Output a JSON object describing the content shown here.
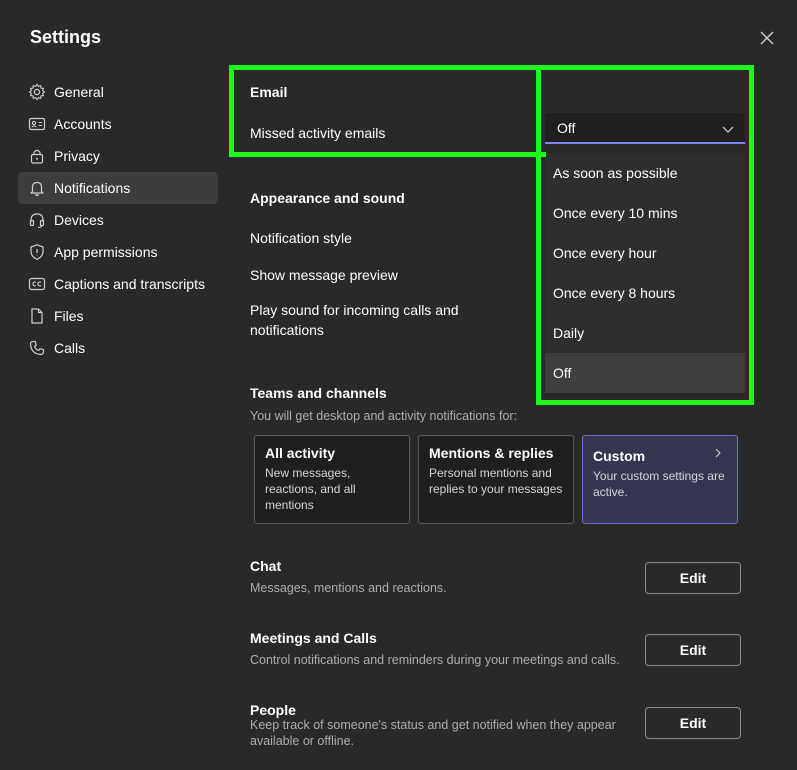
{
  "window": {
    "title": "Settings"
  },
  "sidebar": {
    "items": [
      {
        "label": "General",
        "icon": "gear-icon"
      },
      {
        "label": "Accounts",
        "icon": "id-card-icon"
      },
      {
        "label": "Privacy",
        "icon": "lock-icon"
      },
      {
        "label": "Notifications",
        "icon": "bell-icon",
        "active": true
      },
      {
        "label": "Devices",
        "icon": "headset-icon"
      },
      {
        "label": "App permissions",
        "icon": "shield-icon"
      },
      {
        "label": "Captions and transcripts",
        "icon": "cc-icon"
      },
      {
        "label": "Files",
        "icon": "file-icon"
      },
      {
        "label": "Calls",
        "icon": "phone-icon"
      }
    ]
  },
  "email": {
    "title": "Email",
    "missed_label": "Missed activity emails",
    "select_value": "Off",
    "options": [
      "As soon as possible",
      "Once every 10 mins",
      "Once every hour",
      "Once every 8 hours",
      "Daily",
      "Off"
    ],
    "selected_option": "Off"
  },
  "appearance": {
    "title": "Appearance and sound",
    "style_label": "Notification style",
    "preview_label": "Show message preview",
    "sound_label_1": "Play sound for incoming calls and",
    "sound_label_2": "notifications"
  },
  "teams": {
    "title": "Teams and channels",
    "subtitle": "You will get desktop and activity notifications for:",
    "cards": [
      {
        "title": "All activity",
        "desc": "New messages, reactions, and all mentions"
      },
      {
        "title": "Mentions & replies",
        "desc": "Personal mentions and replies to your messages"
      },
      {
        "title": "Custom",
        "desc": "Your custom settings are active."
      }
    ]
  },
  "chat": {
    "title": "Chat",
    "subtitle": "Messages, mentions and reactions.",
    "button": "Edit"
  },
  "meetings": {
    "title": "Meetings and Calls",
    "subtitle": "Control notifications and reminders during your meetings and calls.",
    "button": "Edit"
  },
  "people": {
    "title": "People",
    "subtitle_1": "Keep track of someone's status and get notified when they appear",
    "subtitle_2": "available or offline.",
    "button": "Edit"
  },
  "colors": {
    "accent": "#7f85f5",
    "highlight": "#1ff51f",
    "background": "#292929"
  }
}
